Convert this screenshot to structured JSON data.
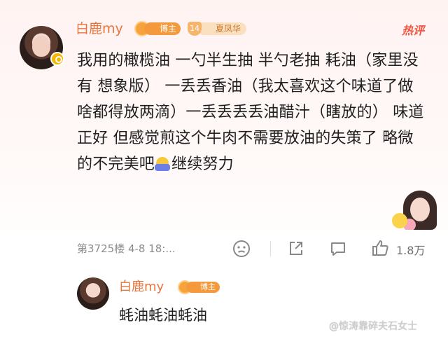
{
  "comment": {
    "username": "白鹿my",
    "fan_badge_label": "博主",
    "level_number": "14",
    "level_badge_label": "夏凤华",
    "hot_label": "热评",
    "content_main": "我用的橄榄油 一勺半生抽 半勺老抽 耗油（家里没有 想象版） 一丢丢香油（我太喜欢这个味道了做啥都得放两滴）一丢丢丢丢油醋汁（瞎放的） 味道正好 但感觉煎这个牛肉不需要放油的失策了 略微的不完美吧",
    "content_tail": "继续努力",
    "floor_time": "第3725楼 4-8 18:...",
    "like_count": "1.8万"
  },
  "reply": {
    "username": "白鹿my",
    "fan_badge_label": "博主",
    "content": "蚝油蚝油蚝油"
  },
  "watermark": "@惊涛靠碎夫石女士",
  "icons": {
    "verified": "verified-badge-icon",
    "emoji": "emoji-icon",
    "share": "share-icon",
    "comment": "comment-icon",
    "like": "thumbs-up-icon"
  },
  "colors": {
    "username": "#e8743b",
    "hot": "#f0543f",
    "meta": "#8c8c8c"
  }
}
